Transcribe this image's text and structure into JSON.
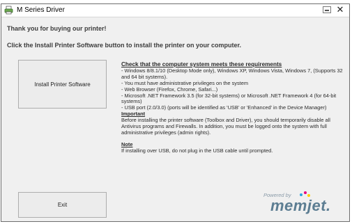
{
  "window": {
    "title": "M Series Driver"
  },
  "header": {
    "thanks": "Thank you for buying our printer!",
    "instruction": "Click the Install Printer Software button to install the printer on your computer."
  },
  "buttons": {
    "install": "Install Printer Software",
    "exit": "Exit"
  },
  "requirements": {
    "heading": "Check that the computer system meets these requirements",
    "items": [
      "- Windows 8/8.1/10 (Desktop Mode only), Windows XP, Windows Vista, Windows 7, (Supports 32 and 64 bit systems).",
      "- You must have administrative privileges on the system",
      "- Web Browser (Firefox, Chrome, Safari...)",
      "- Microsoft .NET Framework 3.5 (for 32-bit systems) or Microsoft .NET Framework 4 (for 64-bit systems)",
      "- USB port (2.0/3.0) (ports will be identified as 'USB' or 'Enhanced' in the Device Manager)"
    ]
  },
  "important": {
    "heading": "Important",
    "text": "Before installing the printer software (Toolbox and Driver), you should temporarily disable all Antivirus programs and Firewalls. In addition, you must be logged onto the system with full administrative privileges (admin rights)."
  },
  "note": {
    "heading": "Note",
    "text": "If installing over USB, do not plug in the USB cable until prompted."
  },
  "logo": {
    "powered_by": "Powered by",
    "brand": "memjet.",
    "colors": [
      "#2aa7e0",
      "#e6007e",
      "#ffd200"
    ]
  },
  "icons": {
    "app": "printer-icon",
    "minimize": "minimize-icon",
    "close": "close-icon"
  }
}
